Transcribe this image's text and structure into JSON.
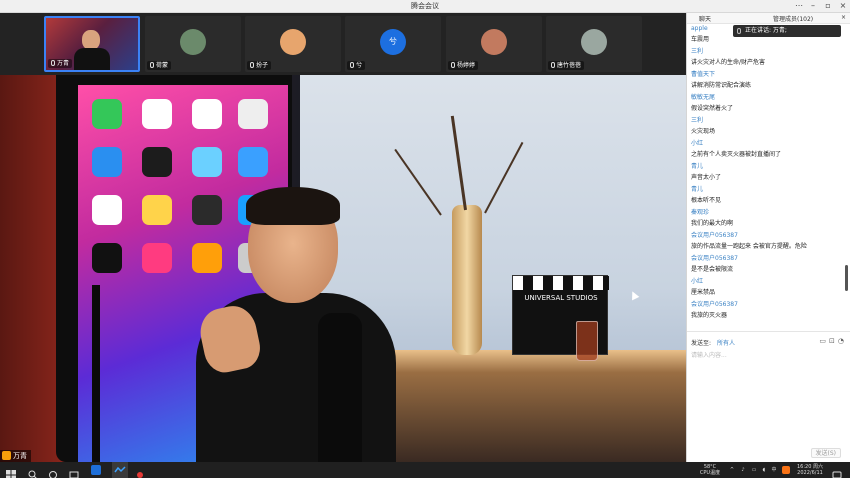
{
  "window": {
    "title": "腾会会议"
  },
  "strip": {
    "tiles": [
      {
        "name": "万青",
        "active": true,
        "avatar_color": "#a13232"
      },
      {
        "name": "荷蒙",
        "avatar_color": "#6b8a6b"
      },
      {
        "name": "扮子",
        "avatar_color": "#e7a56d"
      },
      {
        "name": "兮",
        "avatar_color": "#1d6fe0",
        "initial": "兮"
      },
      {
        "name": "杨婷婷",
        "avatar_color": "#c27a5f"
      },
      {
        "name": "唐竹蓓蓓",
        "avatar_color": "#9aa7a0"
      }
    ]
  },
  "main_video": {
    "name": "万青",
    "clapper_brand": "UNIVERSAL STUDIOS"
  },
  "chat": {
    "tab_label": "聊天",
    "members_label": "管理成员(102)",
    "speaking": "正在讲话: 万青;",
    "messages": [
      {
        "sender": "apple",
        "text": "车震用"
      },
      {
        "sender": "三利",
        "text": "讲火灾对人的生命/财产危害"
      },
      {
        "sender": "曹值天下",
        "text": "讲解消防常识配合演练"
      },
      {
        "sender": "敏敏无尾",
        "text": "假设突然着火了"
      },
      {
        "sender": "三利",
        "text": "火灾现场"
      },
      {
        "sender": "小红",
        "text": "之前有个人卖灭火器被封直播间了"
      },
      {
        "sender": "青儿",
        "text": "声音太小了"
      },
      {
        "sender": "青儿",
        "text": "根本听不见"
      },
      {
        "sender": "秦观珍",
        "text": "我们的最大的啊"
      },
      {
        "sender": "会议用户056387",
        "text": "旅的作品流量一跑起来 会被官方提醒。危险"
      },
      {
        "sender": "会议用户056387",
        "text": "是不是会被限流"
      },
      {
        "sender": "小红",
        "text": "厘米禁品"
      },
      {
        "sender": "会议用户056387",
        "text": "我旅的灭火器"
      }
    ],
    "composer": {
      "to_label": "发送至:",
      "to_value": "所有人",
      "placeholder": "请输入内容...",
      "send_label": "发送(S)"
    }
  },
  "taskbar": {
    "weather": "58°C",
    "weather_sub": "CPU温度",
    "ime": "中",
    "time": "16:20 周六",
    "date": "2022/6/11"
  }
}
